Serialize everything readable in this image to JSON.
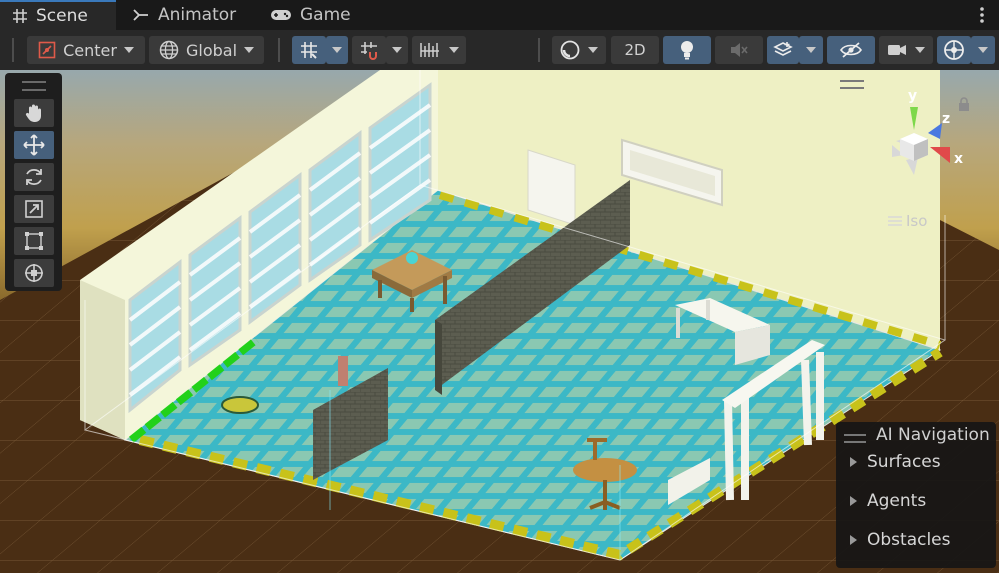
{
  "tabs": [
    {
      "label": "Scene",
      "icon": "grid-icon",
      "active": true
    },
    {
      "label": "Animator",
      "icon": "animator-icon",
      "active": false
    },
    {
      "label": "Game",
      "icon": "gamepad-icon",
      "active": false
    }
  ],
  "toolbar": {
    "pivot_mode": "Center",
    "pivot_rotation": "Global",
    "mode_2d": "2D"
  },
  "gizmo": {
    "x": "x",
    "y": "y",
    "z": "z"
  },
  "projection": "Iso",
  "overlay": {
    "title": "AI Navigation",
    "items": [
      "Surfaces",
      "Agents",
      "Obstacles"
    ]
  },
  "colors": {
    "accent": "#46607c",
    "floor": "#3ab7c3",
    "wall": "#f0f2c8",
    "grass": "#1fc91a",
    "ground": "#4a2e14"
  }
}
